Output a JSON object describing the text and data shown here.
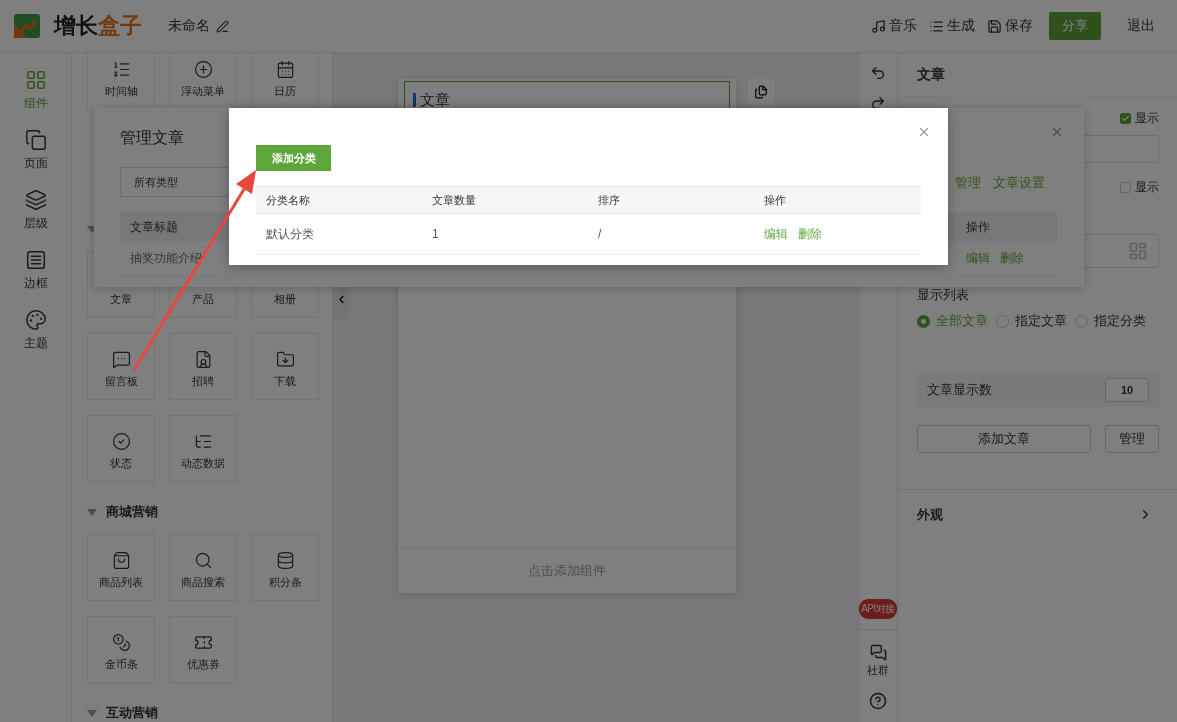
{
  "header": {
    "logo_primary": "增长",
    "logo_accent": "盒子",
    "doc_title": "未命名",
    "actions": [
      "音乐",
      "生成",
      "保存"
    ],
    "share": "分享",
    "exit": "退出"
  },
  "rail": [
    {
      "label": "组件",
      "selected": true
    },
    {
      "label": "页面",
      "selected": false
    },
    {
      "label": "层级",
      "selected": false
    },
    {
      "label": "边框",
      "selected": false
    },
    {
      "label": "主题",
      "selected": false
    }
  ],
  "component_groups": [
    {
      "cards": [
        "时间轴",
        "浮动菜单",
        "日历"
      ]
    },
    {
      "expanded": true,
      "cards": [
        "文章",
        "产品",
        "相册",
        "留言板",
        "招聘",
        "下载",
        "状态",
        "动态数据"
      ]
    },
    {
      "expanded": true,
      "title": "商城营销",
      "cards": [
        "商品列表",
        "商品搜索",
        "积分条",
        "金币条",
        "优惠券"
      ]
    },
    {
      "expanded": true,
      "title": "互动营销"
    }
  ],
  "canvas": {
    "block_title": "文章",
    "add_hint": "点击添加组件"
  },
  "side_tools": {
    "api_badge": "API对接",
    "community": "社群"
  },
  "props_panel": {
    "title": "文章",
    "show_title": {
      "label": "显示",
      "checked": true
    },
    "show_extra": {
      "label": "显示",
      "checked": false
    },
    "list_label": "显示列表",
    "list_modes": [
      {
        "label": "全部文章",
        "selected": true
      },
      {
        "label": "指定文章",
        "selected": false
      },
      {
        "label": "指定分类",
        "selected": false
      }
    ],
    "count_label": "文章显示数",
    "count_value": "10",
    "add_button": "添加文章",
    "manage_button": "管理",
    "appearance": "外观"
  },
  "manage_dialog": {
    "title": "管理文章",
    "filter_value": "所有类型",
    "tabs": [
      "管理",
      "文章设置"
    ],
    "columns": [
      "文章标题",
      "操作"
    ],
    "rows": [
      {
        "title": "抽奖功能介绍",
        "actions": [
          "编辑",
          "删除"
        ]
      }
    ]
  },
  "category_dialog": {
    "add_button": "添加分类",
    "columns": [
      "分类名称",
      "文章数量",
      "排序",
      "操作"
    ],
    "rows": [
      {
        "cells": [
          "默认分类",
          "1",
          "/"
        ],
        "actions": [
          "编辑",
          "删除"
        ]
      }
    ]
  }
}
